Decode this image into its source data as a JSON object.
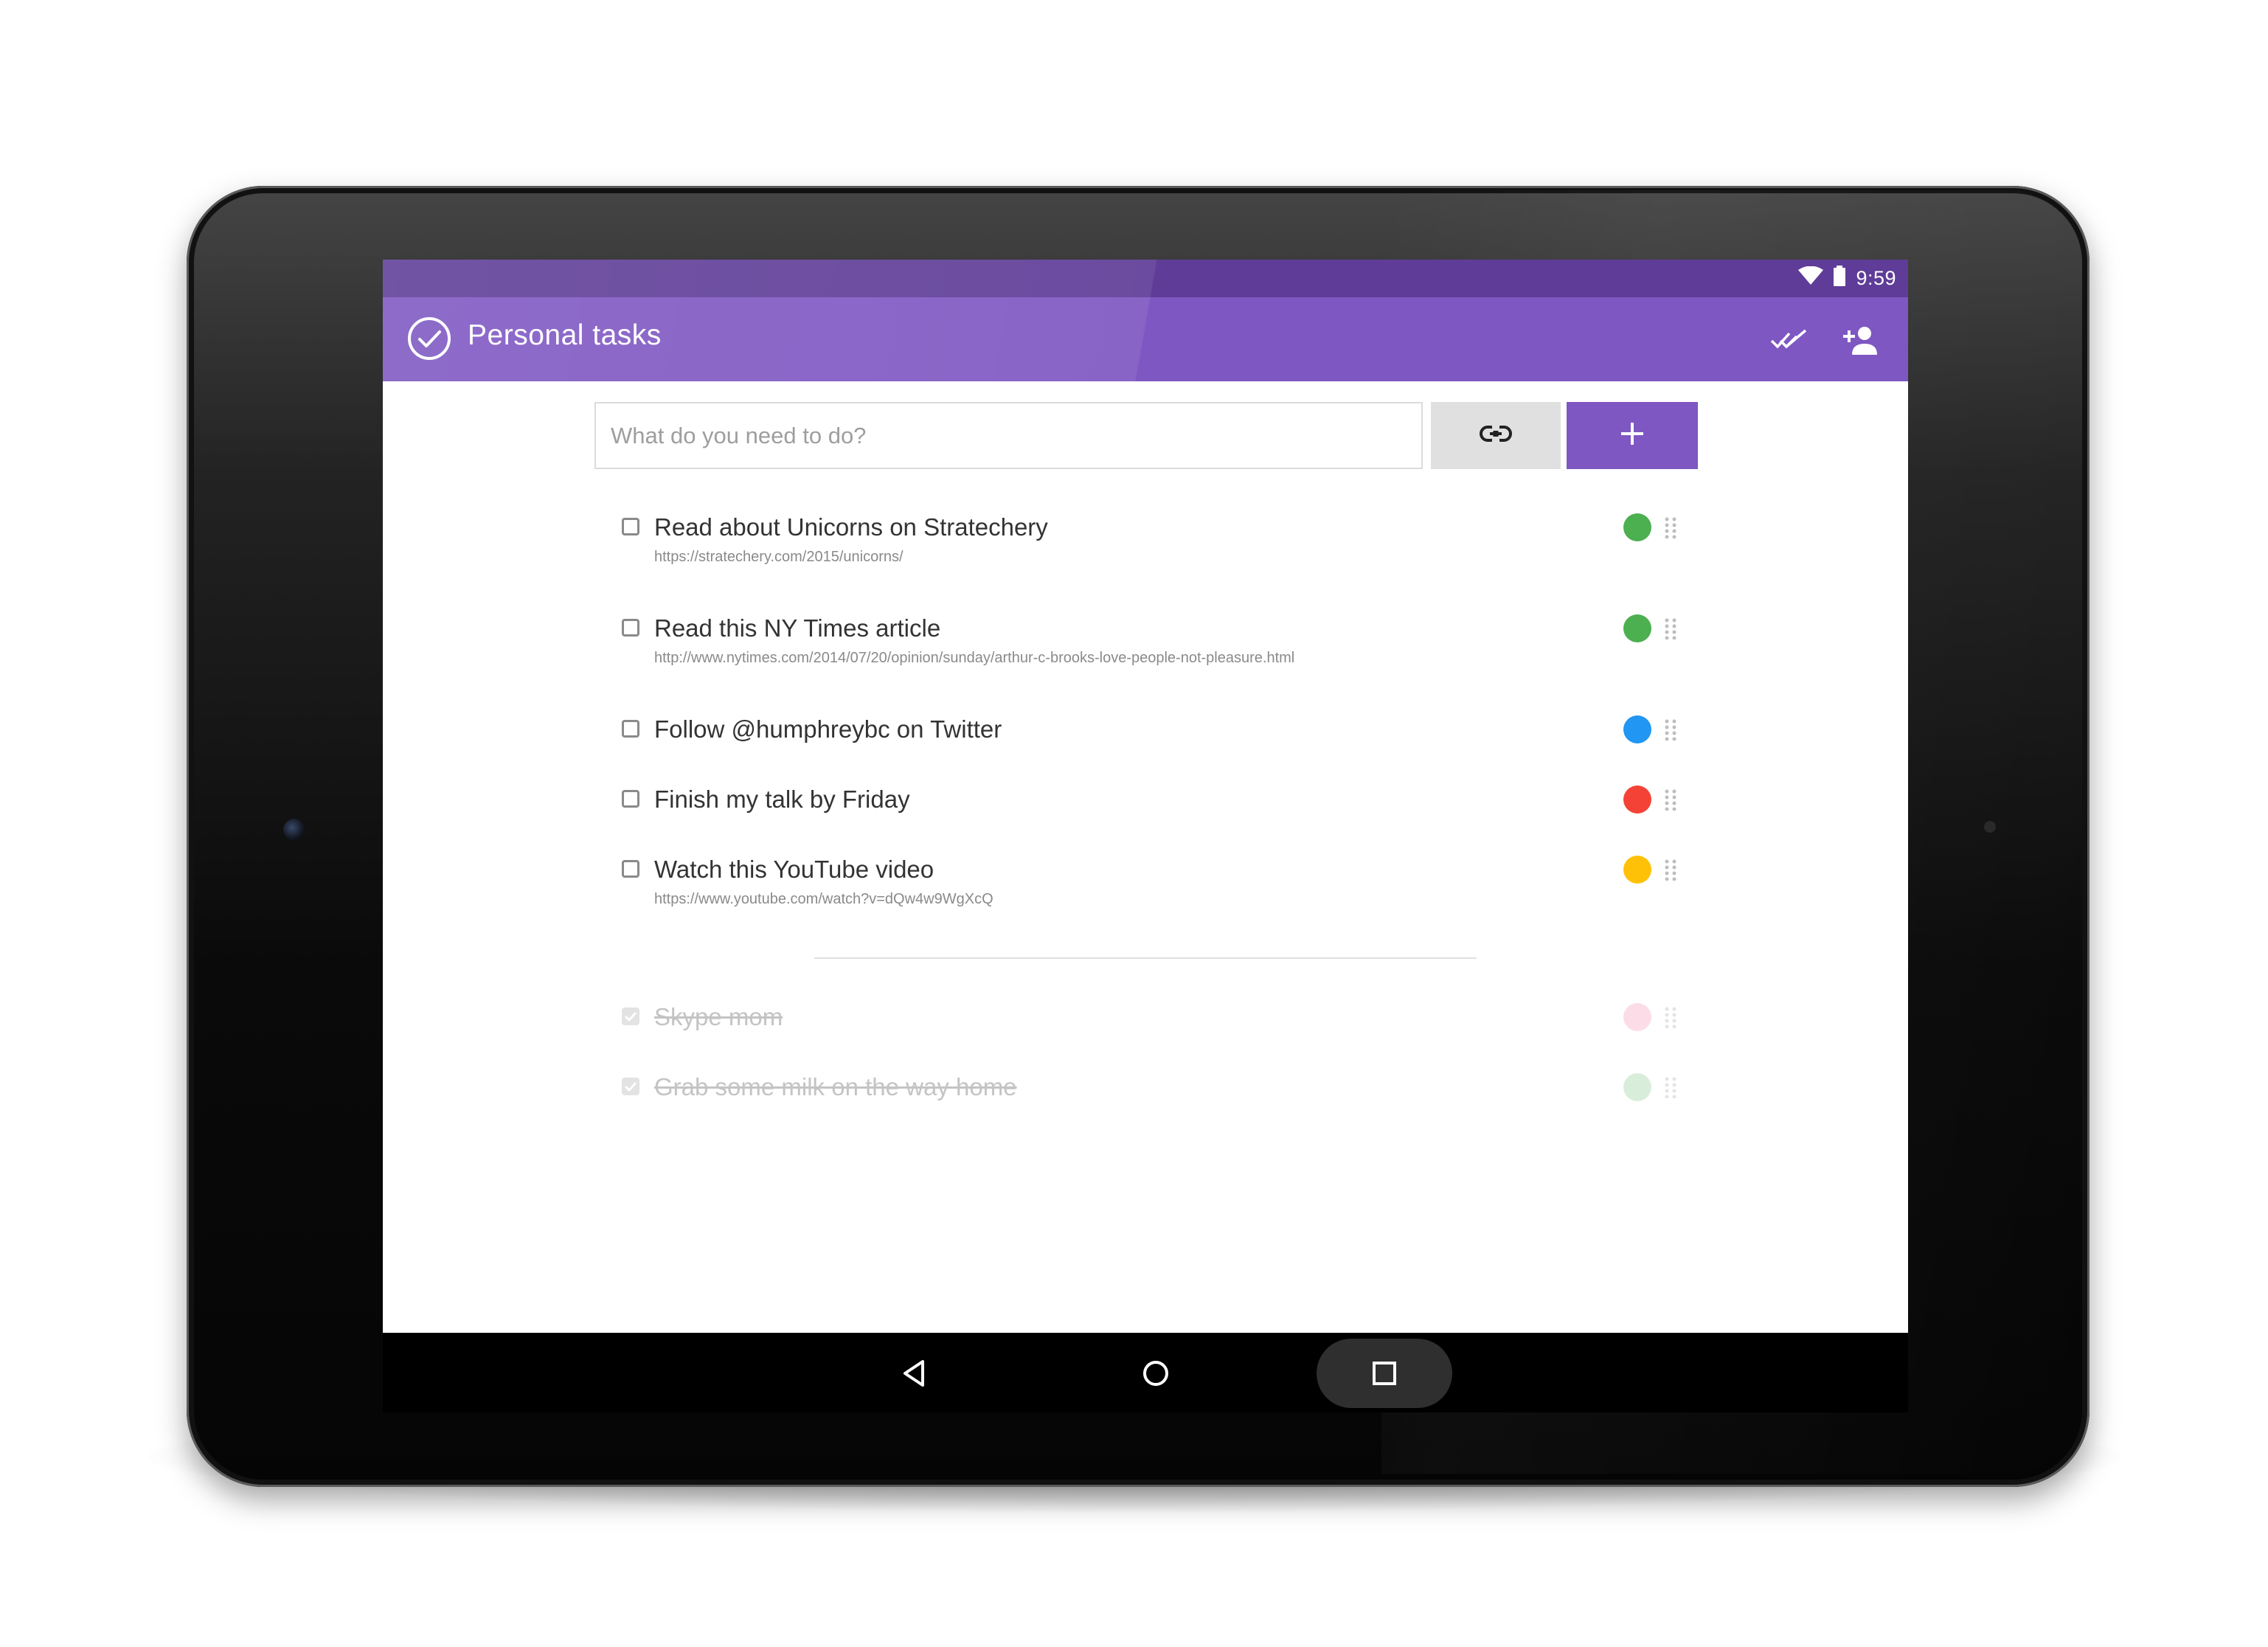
{
  "status_bar": {
    "time": "9:59",
    "icons": [
      "wifi-icon",
      "battery-icon"
    ]
  },
  "app_bar": {
    "title": "Personal tasks",
    "logo_icon": "checkmark-circle-icon",
    "actions": [
      "done-all-icon",
      "person-add-icon"
    ]
  },
  "add_task": {
    "placeholder": "What do you need to do?",
    "link_icon": "link-icon",
    "add_icon": "plus-icon"
  },
  "tasks": [
    {
      "title": "Read about Unicorns on Stratechery",
      "url": "https://stratechery.com/2015/unicorns/",
      "color": "#4caf50",
      "done": false
    },
    {
      "title": "Read this NY Times article",
      "url": "http://www.nytimes.com/2014/07/20/opinion/sunday/arthur-c-brooks-love-people-not-pleasure.html",
      "color": "#4caf50",
      "done": false
    },
    {
      "title": "Follow @humphreybc on Twitter",
      "url": "",
      "color": "#2196f3",
      "done": false
    },
    {
      "title": "Finish my talk by Friday",
      "url": "",
      "color": "#f44336",
      "done": false
    },
    {
      "title": "Watch this YouTube video",
      "url": "https://www.youtube.com/watch?v=dQw4w9WgXcQ",
      "color": "#ffc107",
      "done": false
    }
  ],
  "completed_tasks": [
    {
      "title": "Skype mom",
      "color": "#f8bbd0",
      "done": true
    },
    {
      "title": "Grab some milk on the way home",
      "color": "#c8e6c9",
      "done": true
    }
  ],
  "colors": {
    "accent": "#7e57c2",
    "status_bar": "#5e3c97"
  },
  "nav_bar": [
    "back-icon",
    "home-icon",
    "recents-icon"
  ]
}
